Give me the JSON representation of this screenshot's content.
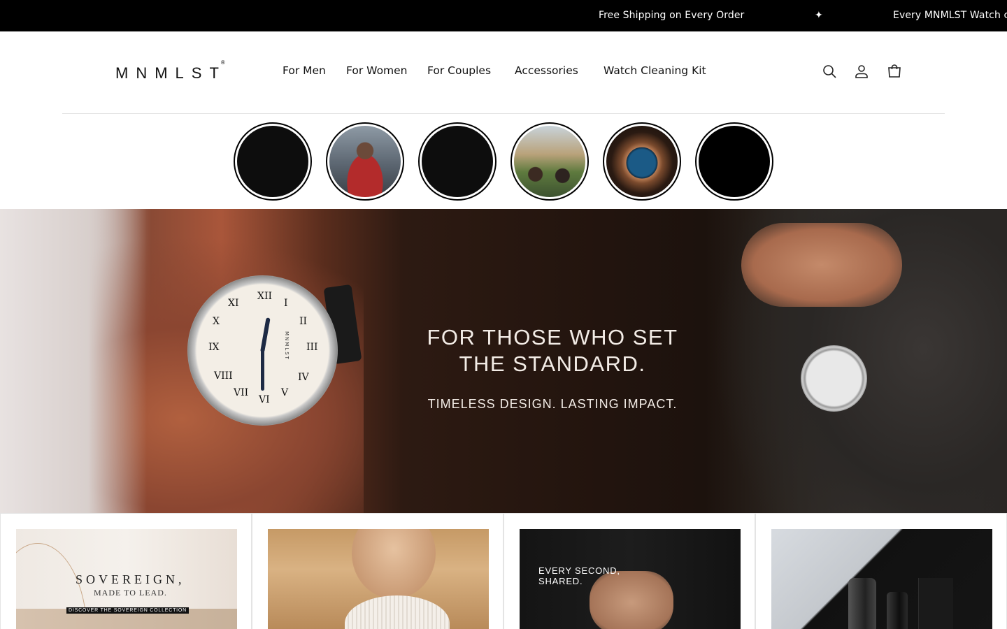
{
  "announcement": {
    "message_1": "Free Shipping on Every Order",
    "separator": "✦",
    "message_2": "Every MNMLST Watch c"
  },
  "header": {
    "logo": "MNMLST",
    "logo_mark": "®",
    "nav": [
      "For Men",
      "For Women",
      "For Couples",
      "Accessories",
      "Watch Cleaning Kit"
    ],
    "icons": [
      "search-icon",
      "account-icon",
      "cart-icon"
    ]
  },
  "stories": {
    "count": 6
  },
  "hero": {
    "title_line_1": "FOR THOSE WHO SET",
    "title_line_2": "THE STANDARD.",
    "subtitle": "TIMELESS DESIGN. LASTING IMPACT.",
    "watch_brand": "MNMLST"
  },
  "collections": {
    "sovereign": {
      "title": "SOVEREIGN,",
      "tagline": "MADE TO LEAD.",
      "cta": "DISCOVER THE SOVEREIGN COLLECTION"
    },
    "couples": {
      "line_1": "EVERY SECOND,",
      "line_2": "SHARED."
    }
  },
  "colors": {
    "announcement_bg": "#000000",
    "text": "#111111",
    "hero_text": "#f3ece6"
  }
}
